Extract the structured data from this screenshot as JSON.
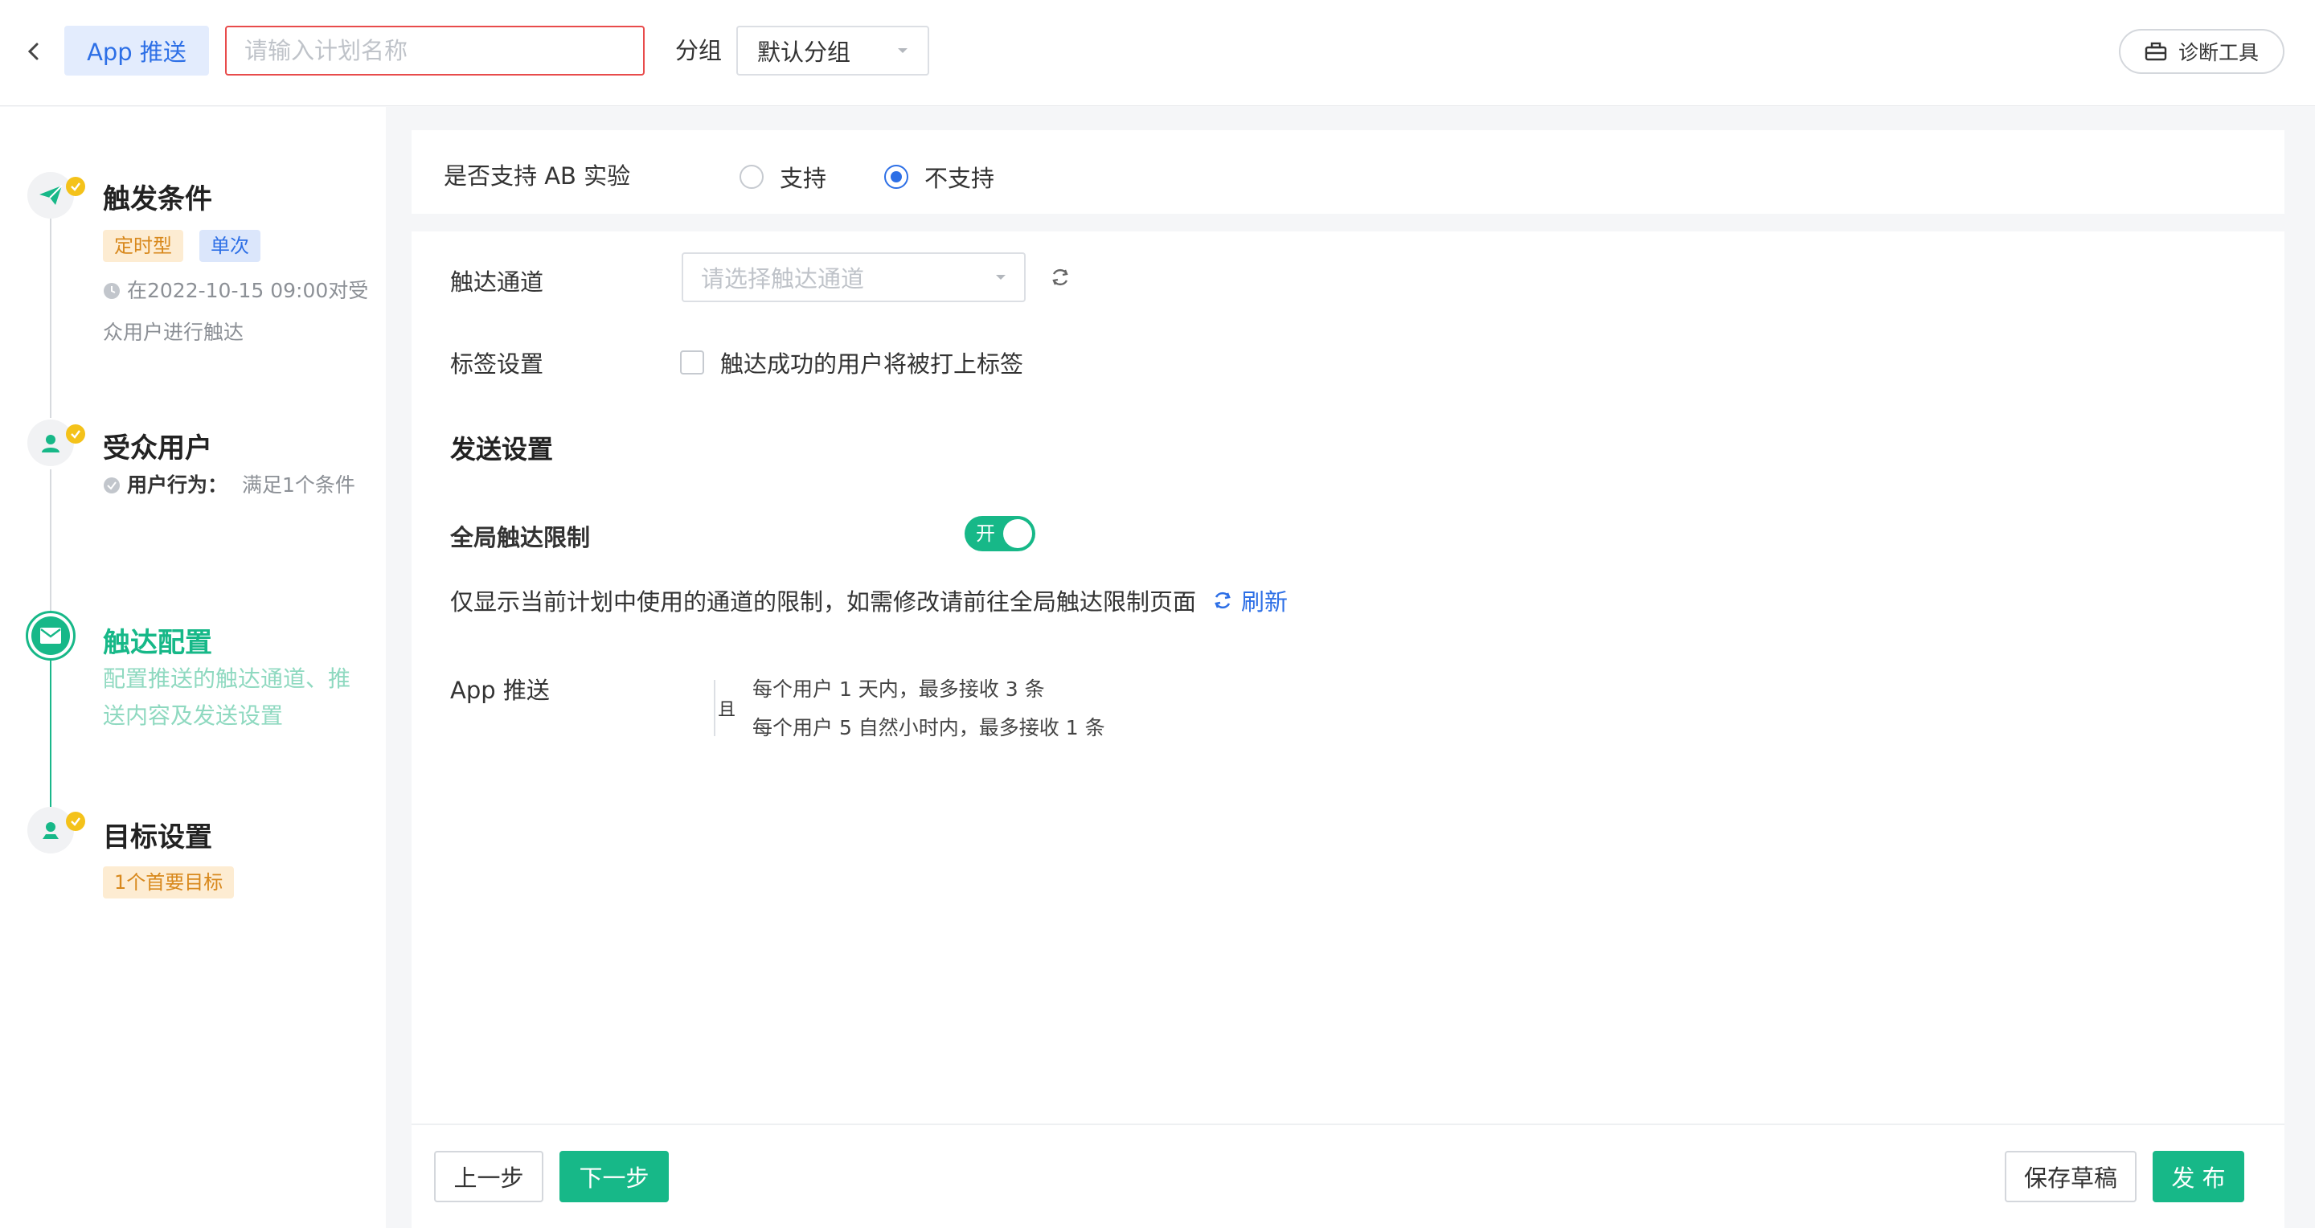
{
  "header": {
    "app_tag": "App 推送",
    "name_placeholder": "请输入计划名称",
    "group_label": "分组",
    "group_value": "默认分组",
    "diagnose_label": "诊断工具"
  },
  "steps": [
    {
      "title": "触发条件",
      "badges": [
        "定时型",
        "单次"
      ],
      "desc_lines": [
        "在2022-10-15 09:00对受",
        "众用户进行触达"
      ]
    },
    {
      "title": "受众用户",
      "desc_label": "用户行为：",
      "desc_value": "满足1个条件"
    },
    {
      "title": "触达配置",
      "desc_lines": [
        "配置推送的触达通道、推",
        "送内容及发送设置"
      ]
    },
    {
      "title": "目标设置",
      "badges": [
        "1个首要目标"
      ]
    }
  ],
  "ab": {
    "label": "是否支持 AB 实验",
    "options": [
      "支持",
      "不支持"
    ],
    "selected": "不支持"
  },
  "channel": {
    "label": "触达通道",
    "placeholder": "请选择触达通道"
  },
  "tag": {
    "label": "标签设置",
    "checkbox_text": "触达成功的用户将被打上标签"
  },
  "send": {
    "section_title": "发送设置",
    "limit_label": "全局触达限制",
    "toggle_text": "开",
    "note": "仅显示当前计划中使用的通道的限制，如需修改请前往全局触达限制页面",
    "refresh": "刷新",
    "channel_name": "App 推送",
    "and_text": "且",
    "rules": [
      "每个用户 1 天内，最多接收 3 条",
      "每个用户 5 自然小时内，最多接收 1 条"
    ]
  },
  "footer": {
    "prev": "上一步",
    "next": "下一步",
    "save_draft": "保存草稿",
    "publish": "发 布"
  },
  "colors": {
    "accent": "#17b888",
    "link": "#2d6fe6",
    "error": "#e84b4b",
    "check": "#f4c21a"
  }
}
